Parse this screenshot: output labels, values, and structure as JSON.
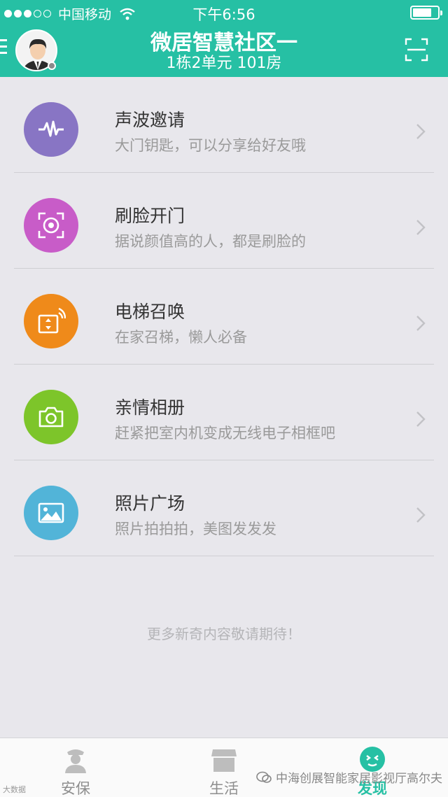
{
  "status_bar": {
    "carrier": "中国移动",
    "time": "下午6:56"
  },
  "header": {
    "title": "微居智慧社区一",
    "subtitle": "1栋2单元 101房"
  },
  "items": [
    {
      "title": "声波邀请",
      "desc": "大门钥匙，可以分享给好友哦",
      "icon": "soundwave-icon",
      "color": "#8875c4"
    },
    {
      "title": "刷脸开门",
      "desc": "据说颜值高的人，都是刷脸的",
      "icon": "face-scan-icon",
      "color": "#c85cc8"
    },
    {
      "title": "电梯召唤",
      "desc": "在家召梯，懒人必备",
      "icon": "elevator-icon",
      "color": "#ef8a1a"
    },
    {
      "title": "亲情相册",
      "desc": "赶紧把室内机变成无线电子相框吧",
      "icon": "camera-icon",
      "color": "#7dc52a"
    },
    {
      "title": "照片广场",
      "desc": "照片拍拍拍，美图发发发",
      "icon": "picture-icon",
      "color": "#52b4d8"
    }
  ],
  "more_text": "更多新奇内容敬请期待！",
  "tabs": [
    {
      "label": "安保",
      "icon": "guard-icon"
    },
    {
      "label": "生活",
      "icon": "shop-icon"
    },
    {
      "label": "发现",
      "icon": "discover-icon"
    }
  ],
  "watermark_left": "大数据",
  "watermark_right": "中海创展智能家居影视厅高尔夫",
  "colors": {
    "brand": "#26c0a4",
    "background": "#e8e7ec"
  }
}
